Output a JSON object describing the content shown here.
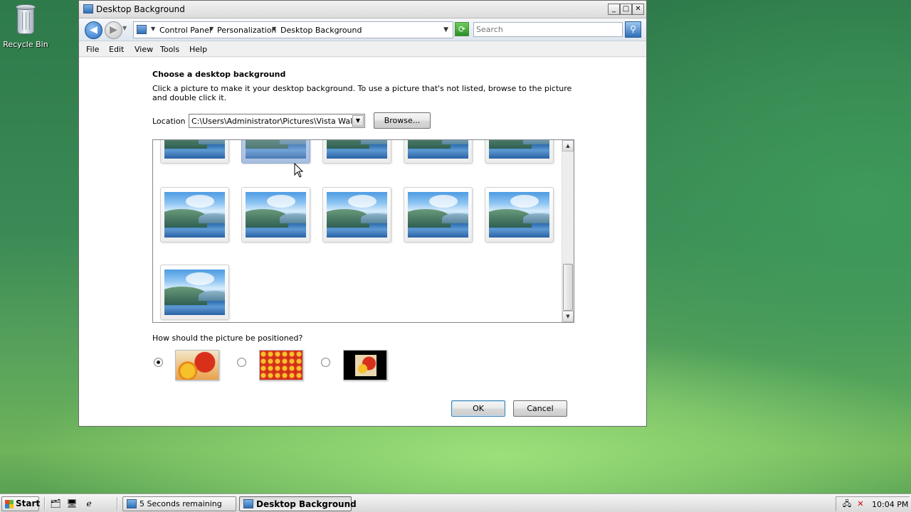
{
  "desktop": {
    "recycle_bin_label": "Recycle Bin"
  },
  "window": {
    "title": "Desktop Background",
    "controls": {
      "minimize": "_",
      "maximize": "□",
      "close": "✕"
    }
  },
  "addressbar": {
    "breadcrumbs": [
      "Control Panel",
      "Personalization",
      "Desktop Background"
    ],
    "search_placeholder": "Search"
  },
  "menu": [
    "File",
    "Edit",
    "View",
    "Tools",
    "Help"
  ],
  "content": {
    "heading": "Choose a desktop background",
    "description": "Click a picture to make it your desktop background. To use a picture that's not listed, browse to the picture and double click it.",
    "location_label": "Location",
    "location_value": "C:\\Users\\Administrator\\Pictures\\Vista Wallpapers",
    "browse_label": "Browse...",
    "position_question": "How should the picture be positioned?",
    "position_options": [
      {
        "name": "Fit to screen",
        "selected": true
      },
      {
        "name": "Tile",
        "selected": false
      },
      {
        "name": "Center",
        "selected": false
      }
    ],
    "ok_label": "OK",
    "cancel_label": "Cancel"
  },
  "gallery": {
    "rows": [
      5,
      5,
      1
    ],
    "selected_index": 1,
    "thumbnail_icon": "landscape-wallpaper-thumbnail"
  },
  "taskbar": {
    "start_label": "Start",
    "tasks": [
      {
        "label": "5 Seconds remaining",
        "active": false
      },
      {
        "label": "Desktop Background",
        "active": true
      }
    ],
    "clock": "10:04 PM"
  }
}
